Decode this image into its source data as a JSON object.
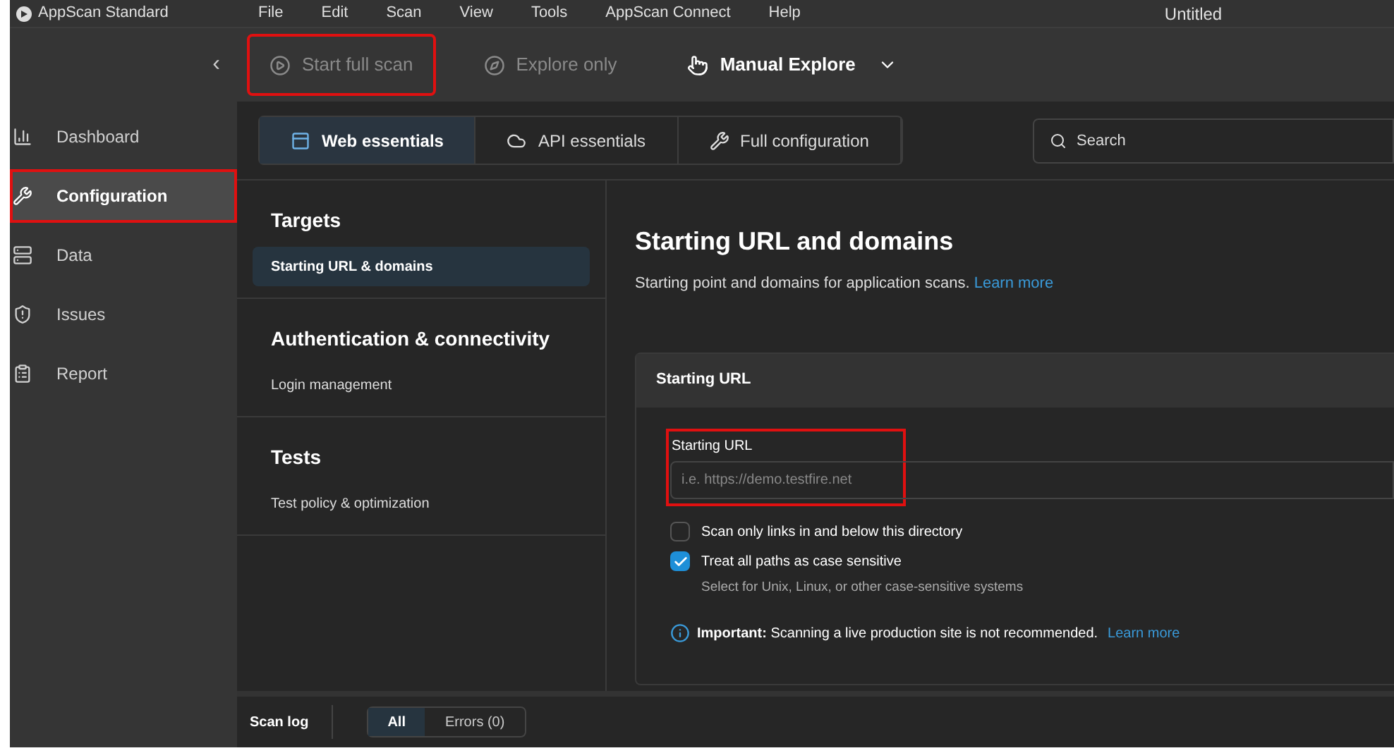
{
  "window": {
    "app_name": "AppScan Standard",
    "title": "Untitled"
  },
  "menu": [
    "File",
    "Edit",
    "Scan",
    "View",
    "Tools",
    "AppScan Connect",
    "Help"
  ],
  "toolbar": [
    {
      "kind": "start",
      "label": "Start full scan",
      "disabled": true,
      "highlighted": true
    },
    {
      "kind": "explore",
      "label": "Explore only",
      "disabled": true,
      "highlighted": false
    },
    {
      "kind": "manual",
      "label": "Manual Explore",
      "disabled": false,
      "highlighted": false
    }
  ],
  "collapse_button": "‹",
  "sidebar": {
    "items": [
      {
        "kind": "dashboard",
        "label": "Dashboard",
        "selected": false,
        "highlighted": false
      },
      {
        "kind": "configuration",
        "label": "Configuration",
        "selected": true,
        "highlighted": true
      },
      {
        "kind": "data",
        "label": "Data",
        "selected": false,
        "highlighted": false
      },
      {
        "kind": "issues",
        "label": "Issues",
        "selected": false,
        "highlighted": false
      },
      {
        "kind": "report",
        "label": "Report",
        "selected": false,
        "highlighted": false
      }
    ]
  },
  "tabs": [
    {
      "kind": "web",
      "label": "Web essentials",
      "selected": true
    },
    {
      "kind": "api",
      "label": "API essentials",
      "selected": false
    },
    {
      "kind": "full",
      "label": "Full configuration",
      "selected": false
    }
  ],
  "search": {
    "placeholder": "Search"
  },
  "nav": [
    {
      "heading": "Targets",
      "items": [
        {
          "label": "Starting URL & domains",
          "selected": true
        }
      ]
    },
    {
      "heading": "Authentication & connectivity",
      "items": [
        {
          "label": "Login management",
          "selected": false
        }
      ]
    },
    {
      "heading": "Tests",
      "items": [
        {
          "label": "Test policy & optimization",
          "selected": false
        }
      ]
    }
  ],
  "content": {
    "title": "Starting URL and domains",
    "description": "Starting point and domains for application scans.",
    "description_link": "Learn more",
    "panel": {
      "title": "Starting URL",
      "field": {
        "label": "Starting URL",
        "placeholder": "i.e. https://demo.testfire.net",
        "highlighted": true
      },
      "options": [
        {
          "label": "Scan only links in and below this directory",
          "checked": false
        },
        {
          "label": "Treat all paths as case sensitive",
          "checked": true,
          "hint": "Select for Unix, Linux, or other case-sensitive systems"
        }
      ],
      "notice": {
        "text": "**Important:** Scanning a live production site is not recommended.",
        "link": "Learn more"
      }
    }
  },
  "scan_log": {
    "title": "Scan log",
    "filters": [
      {
        "label": "All",
        "selected": true
      },
      {
        "label": "Errors (0)",
        "selected": false
      }
    ]
  }
}
